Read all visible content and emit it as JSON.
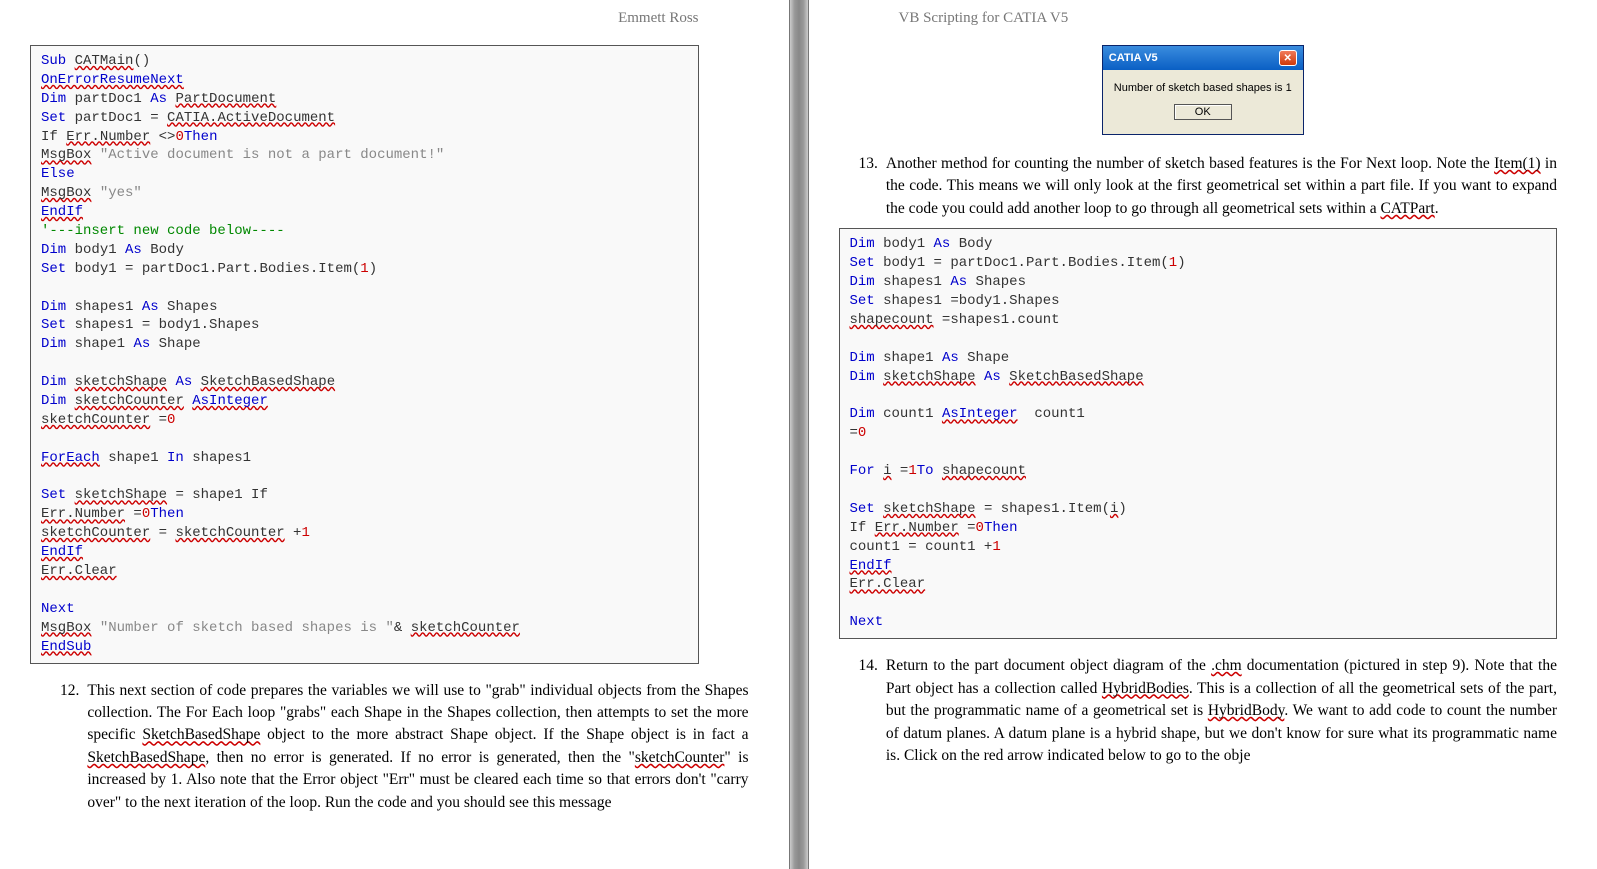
{
  "left": {
    "header": "Emmett Ross",
    "code_raw": "<span class='kw'>Sub</span> <span class='sq'>CATMain</span>()\n<span class='kw sq'>OnErrorResumeNext</span>\n<span class='kw'>Dim</span> partDoc1 <span class='kw'>As</span> <span class='sq'>PartDocument</span>\n<span class='kw'>Set</span> partDoc1 = <span class='sq'>CATIA.ActiveDocument</span>\nIf <span class='sq'>Err.Number</span> &lt;&gt;<span class='num'>0</span><span class='kw'>Then</span>\n<span class='sq'>MsgBox</span> <span class='str'>\"Active document is not a part document!\"</span>\n<span class='kw'>Else</span>\n<span class='sq'>MsgBox</span> <span class='str'>\"yes\"</span>\n<span class='kw sq'>EndIf</span>\n<span class='cmt'>'---insert new code below----</span>\n<span class='kw'>Dim</span> body1 <span class='kw'>As</span> Body\n<span class='kw'>Set</span> body1 = partDoc1.Part.Bodies.Item(<span class='num'>1</span>)\n\n<span class='kw'>Dim</span> shapes1 <span class='kw'>As</span> Shapes\n<span class='kw'>Set</span> shapes1 = body1.Shapes\n<span class='kw'>Dim</span> shape1 <span class='kw'>As</span> Shape\n\n<span class='kw'>Dim</span> <span class='sq'>sketchShape</span> <span class='kw'>As</span> <span class='sq'>SketchBasedShape</span>\n<span class='kw'>Dim</span> <span class='sq'>sketchCounter</span> <span class='kw sq'>AsInteger</span>\n<span class='sq'>sketchCounter</span> =<span class='num'>0</span>\n\n<span class='kw sq'>ForEach</span> shape1 <span class='kw'>In</span> shapes1\n\n<span class='kw'>Set</span> <span class='sq'>sketchShape</span> = shape1 If\n<span class='sq'>Err.Number</span> =<span class='num'>0</span><span class='kw'>Then</span>\n<span class='sq'>sketchCounter</span> = <span class='sq'>sketchCounter</span> +<span class='num'>1</span>\n<span class='kw sq'>EndIf</span>\n<span class='sq'>Err.Clear</span>\n\n<span class='kw'>Next</span>\n<span class='sq'>MsgBox</span> <span class='str'>\"Number of sketch based shapes is \"</span>&amp; <span class='sq'>sketchCounter</span>\n<span class='kw sq'>EndSub</span>",
    "item_num": "12.",
    "item_text": "This next section of code prepares the variables we will use to \"grab\" individual objects from the Shapes collection. The For Each loop \"grabs\" each Shape in the Shapes collection, then attempts to set the more specific <span class='sq'>SketchBasedShape</span> object to the more abstract Shape object. If the Shape object is in fact a <span class='sq'>SketchBasedShape</span>, then no error is generated. If no error is generated, then the \"<span class='sq'>sketchCounter</span>\" is increased by 1. Also note that the Error object \"Err\" must be cleared each time so that errors don't \"carry over\" to the next iteration of the loop. Run the code and you should see this message"
  },
  "right": {
    "header": "VB Scripting for CATIA V5",
    "dialog": {
      "title": "CATIA V5",
      "message": "Number of sketch based shapes is 1",
      "ok": "OK"
    },
    "item13_num": "13.",
    "item13_text": "Another method for counting the number of sketch based features is the For Next loop. Note the <span class='sq'>Item(1)</span> in the code. This means we will only look at the first geometrical set within a part file. If you want to expand the code you could add another loop to go through all geometrical sets within a <span class='sq'>CATPart</span>.",
    "code_raw": "<span class='kw'>Dim</span> body1 <span class='kw'>As</span> Body\n<span class='kw'>Set</span> body1 = partDoc1.Part.Bodies.Item(<span class='num'>1</span>)\n<span class='kw'>Dim</span> shapes1 <span class='kw'>As</span> Shapes\n<span class='kw'>Set</span> shapes1 =body1.Shapes\n<span class='sq'>shapecount</span> =shapes1.count\n\n<span class='kw'>Dim</span> shape1 <span class='kw'>As</span> Shape\n<span class='kw'>Dim</span> <span class='sq'>sketchShape</span> <span class='kw'>As</span> <span class='sq'>SketchBasedShape</span>\n\n<span class='kw'>Dim</span> count1 <span class='kw sq'>AsInteger</span>  count1\n=<span class='num'>0</span>\n\n<span class='kw'>For</span> <span class='sq'>i</span> =<span class='num'>1</span><span class='kw'>To</span> <span class='sq'>shapecount</span>\n\n<span class='kw'>Set</span> <span class='sq'>sketchShape</span> = shapes1.Item(<span class='sq'>i</span>)\nIf <span class='sq'>Err.Number</span> =<span class='num'>0</span><span class='kw'>Then</span>\ncount1 = count1 +<span class='num'>1</span>\n<span class='kw sq'>EndIf</span>\n<span class='sq'>Err.Clear</span>\n\n<span class='kw'>Next</span>",
    "item14_num": "14.",
    "item14_text": "Return to the part document object diagram of the <span class='sq'>.chm</span> documentation (pictured in step 9). Note that the Part object has a collection called <span class='sq'>HybridBodies</span>. This is a collection of all the geometrical sets of the part, but the programmatic name of a geometrical set is <span class='sq'>HybridBody</span>. We want to add code to count the number of datum planes. A datum plane is a hybrid shape, but we don't know for sure what its programmatic name is. Click on the red arrow indicated below to go to the obje"
  }
}
